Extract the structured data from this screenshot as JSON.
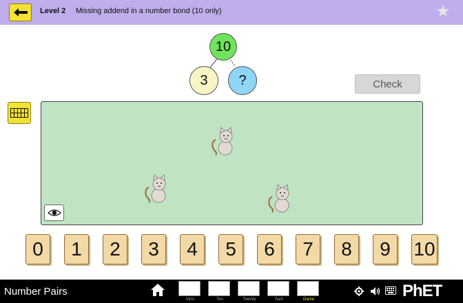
{
  "header": {
    "level_label": "Level 2",
    "description": "Missing addend in a number bond (10 only)",
    "back_icon": "back-arrow-icon",
    "star_icon": "star-icon"
  },
  "number_bond": {
    "total": "10",
    "left": "3",
    "right": "?"
  },
  "check_button": "Check",
  "number_buttons": [
    "0",
    "1",
    "2",
    "3",
    "4",
    "5",
    "6",
    "7",
    "8",
    "9",
    "10"
  ],
  "navbar": {
    "app_title": "Number Pairs",
    "screens": [
      "Intro",
      "Ten",
      "Twenty",
      "Sum",
      "Game"
    ],
    "active_screen": "Game",
    "logo": "PhET"
  },
  "colors": {
    "header_bg": "#c0adeb",
    "play_area_bg": "#bfe3c3",
    "total_circle": "#6fe35c",
    "left_circle": "#f9f4c4",
    "right_circle": "#8fd5f5",
    "button_yellow": "#f3e233",
    "number_tile": "#f2d9a6"
  }
}
